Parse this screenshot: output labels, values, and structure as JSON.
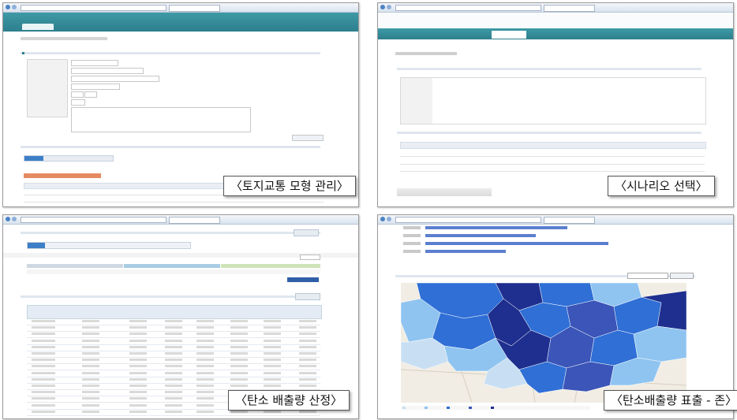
{
  "captions": {
    "land_transport_model": "〈토지교통 모형 관리〉",
    "scenario_select": "〈시나리오 선택〉",
    "carbon_estimate": "〈탄소 배출량 산정〉",
    "carbon_zone": "〈탄소배출량 표출 - 존〉"
  },
  "colors": {
    "teal": "#2d7f8c",
    "map_dark": "#1f2f8f",
    "map_mid": "#2f6fd6",
    "map_light": "#8fc4f0",
    "bar_blue": "#5b7fcf"
  },
  "icons": {
    "browser_nav": "circle-arrow-icon",
    "map_legend": "color-swatch-icon"
  }
}
